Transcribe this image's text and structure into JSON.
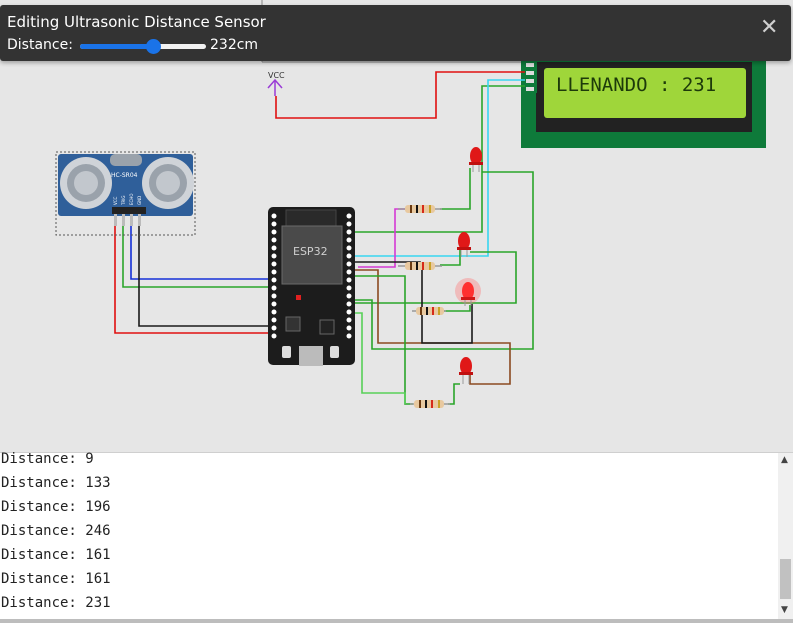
{
  "editor": {
    "title": "Editing Ultrasonic Distance Sensor",
    "distance_label": "Distance:",
    "distance_value": "232cm",
    "slider_fraction": 0.58
  },
  "diagram": {
    "vcc_label": "VCC",
    "lcd_text": "LLENANDO : 231",
    "esp32_label": "ESP32",
    "sensor_label": "HC-SR04",
    "sensor_pins": [
      "VCC",
      "TRIG",
      "ECHO",
      "GND"
    ]
  },
  "serial": {
    "lines": [
      "Distance: 9",
      "Distance: 133",
      "Distance: 196",
      "Distance: 246",
      "Distance: 161",
      "Distance: 161",
      "Distance: 231"
    ]
  },
  "colors": {
    "lcd_bg": "#0e7a3a",
    "lcd_screen": "#9fd63a",
    "esp_board": "#1c1c1c",
    "sensor_board": "#2f5f9a",
    "slider_accent": "#1a73e8"
  }
}
